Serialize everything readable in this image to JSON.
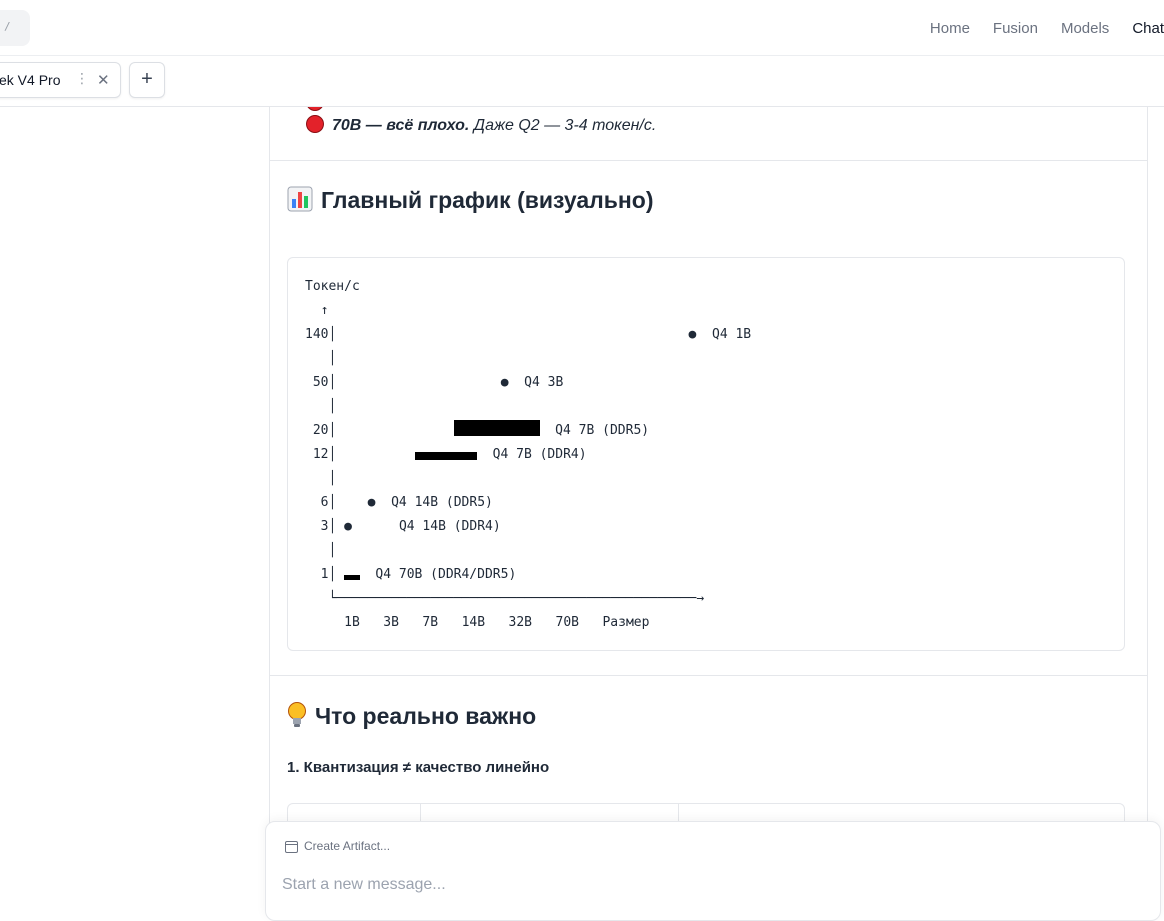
{
  "topbar": {
    "kbd_hint": "/",
    "nav": [
      "Home",
      "Fusion",
      "Models",
      "Chat"
    ],
    "active_nav": "Chat"
  },
  "tabs": {
    "active_tab_label": "ek V4 Pro",
    "menu_glyph": "⋮",
    "close_glyph": "✕",
    "add_glyph": "+"
  },
  "message": {
    "partial_line": "",
    "line_70b_bold": "70B — всё плохо.",
    "line_70b_rest": " Даже Q2 — 3-4 токен/с.",
    "heading_chart": "Главный график (визуально)",
    "chart_ascii": {
      "y_title": "Токен/с",
      "rows": [
        {
          "y": "140",
          "dot_col": 45,
          "label": "Q4 1B"
        },
        {
          "y": "50",
          "dot_col": 21,
          "label": "Q4 3B"
        },
        {
          "y": "20",
          "bar_from": 15,
          "bar_len": 11,
          "label": "Q4 7B (DDR5)"
        },
        {
          "y": "12",
          "bar_from": 10,
          "bar_len": 8,
          "label": "Q4 7B (DDR4)"
        },
        {
          "y": "6",
          "dot_col": 4,
          "label": "Q4 14B (DDR5)"
        },
        {
          "y": "3",
          "dot_col": 1,
          "label": "Q4 14B (DDR4)"
        },
        {
          "y": "1",
          "bar_from": 1,
          "bar_len": 2,
          "label": "Q4 70B (DDR4/DDR5)"
        }
      ],
      "x_labels": [
        "1B",
        "3B",
        "7B",
        "14B",
        "32B",
        "70B",
        "Размер"
      ]
    },
    "heading_important": "Что реально важно",
    "subheading": "1. Квантизация ≠ качество линейно"
  },
  "composer": {
    "artifact_label": "Create Artifact...",
    "placeholder": "Start a new message..."
  },
  "colors": {
    "red_dot": "#e3222a",
    "accent_text": "#111827",
    "muted_text": "#6b7280"
  }
}
